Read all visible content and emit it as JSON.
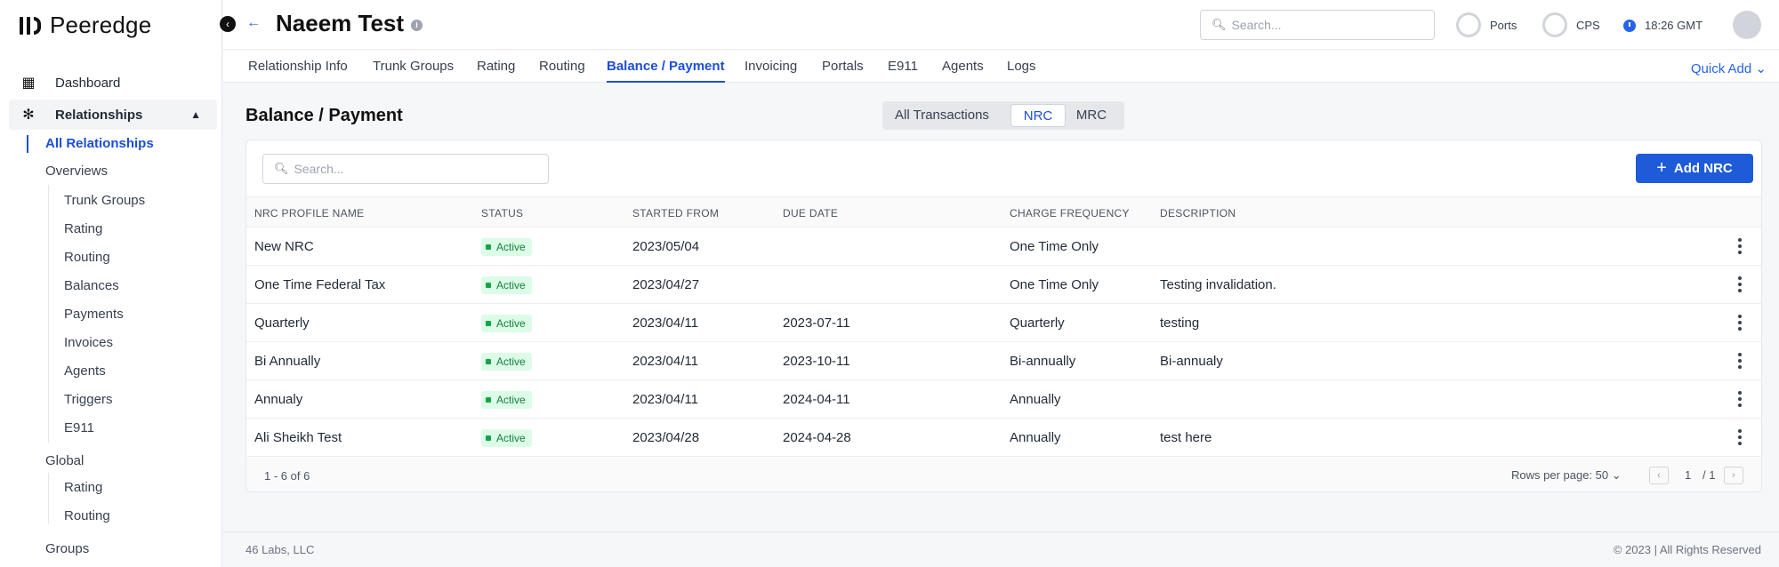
{
  "brand": {
    "name": "Peeredge"
  },
  "sidebar": {
    "dashboard": "Dashboard",
    "relationships": "Relationships",
    "all_relationships": "All Relationships",
    "overviews": "Overviews",
    "overview_items": [
      "Trunk Groups",
      "Rating",
      "Routing",
      "Balances",
      "Payments",
      "Invoices",
      "Agents",
      "Triggers",
      "E911"
    ],
    "global": "Global",
    "global_items": [
      "Rating",
      "Routing"
    ],
    "groups": "Groups"
  },
  "header": {
    "title": "Naeem Test",
    "search_placeholder": "Search...",
    "ports_label": "Ports",
    "cps_label": "CPS",
    "time": "18:26 GMT"
  },
  "tabs": [
    "Relationship Info",
    "Trunk Groups",
    "Rating",
    "Routing",
    "Balance / Payment",
    "Invoicing",
    "Portals",
    "E911",
    "Agents",
    "Logs"
  ],
  "active_tab": "Balance / Payment",
  "quick_add": "Quick Add",
  "section": {
    "title": "Balance / Payment",
    "segments": [
      "All Transactions",
      "NRC",
      "MRC"
    ],
    "active_segment": "NRC"
  },
  "table": {
    "search_placeholder": "Search...",
    "add_button": "Add NRC",
    "columns": [
      "NRC PROFILE NAME",
      "STATUS",
      "STARTED FROM",
      "DUE DATE",
      "CHARGE FREQUENCY",
      "DESCRIPTION"
    ],
    "rows": [
      {
        "name": "New NRC",
        "status": "Active",
        "started": "2023/05/04",
        "due": "",
        "frequency": "One Time Only",
        "description": ""
      },
      {
        "name": "One Time Federal Tax",
        "status": "Active",
        "started": "2023/04/27",
        "due": "",
        "frequency": "One Time Only",
        "description": "Testing invalidation."
      },
      {
        "name": "Quarterly",
        "status": "Active",
        "started": "2023/04/11",
        "due": "2023-07-11",
        "frequency": "Quarterly",
        "description": "testing"
      },
      {
        "name": "Bi Annually",
        "status": "Active",
        "started": "2023/04/11",
        "due": "2023-10-11",
        "frequency": "Bi-annually",
        "description": "Bi-annualy"
      },
      {
        "name": "Annualy",
        "status": "Active",
        "started": "2023/04/11",
        "due": "2024-04-11",
        "frequency": "Annually",
        "description": ""
      },
      {
        "name": "Ali Sheikh Test",
        "status": "Active",
        "started": "2023/04/28",
        "due": "2024-04-28",
        "frequency": "Annually",
        "description": "test here"
      }
    ],
    "count_text": "1 - 6 of 6",
    "rows_per_page": "Rows per page: 50",
    "page_current": "1",
    "page_total": "/ 1"
  },
  "footer": {
    "left": "46 Labs, LLC",
    "right": "© 2023 | All Rights Reserved"
  },
  "colors": {
    "accent": "#1d4ed8",
    "badge_bg": "#dcfce7",
    "badge_text": "#15803d"
  }
}
